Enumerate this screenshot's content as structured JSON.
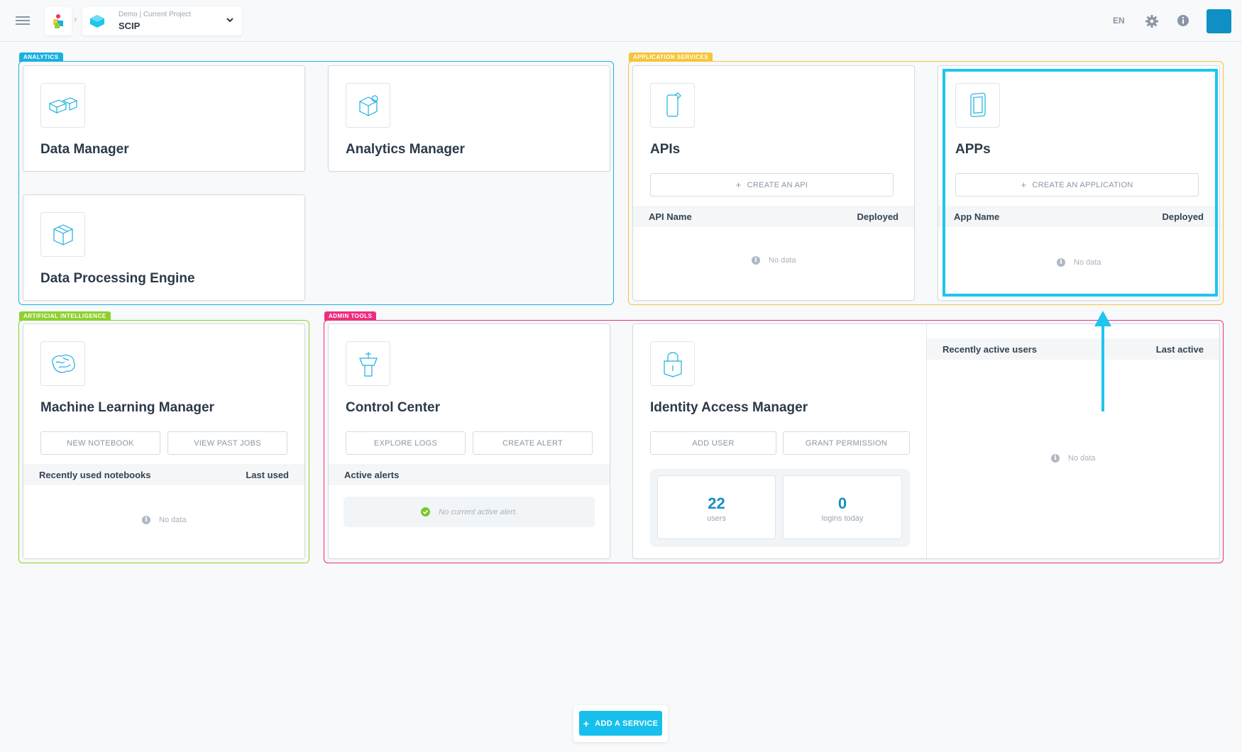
{
  "header": {
    "project_subtitle": "Demo | Current Project",
    "project_name": "SCIP",
    "language": "EN"
  },
  "groups": {
    "analytics": {
      "tag": "ANALYTICS",
      "color": "#1ab0e0"
    },
    "application_services": {
      "tag": "APPLICATION SERVICES",
      "color": "#f7c539"
    },
    "artificial_intelligence": {
      "tag": "ARTIFICIAL INTELLIGENCE",
      "color": "#8dd12e"
    },
    "admin_tools": {
      "tag": "ADMIN TOOLS",
      "color": "#ef2d7e"
    }
  },
  "cards": {
    "data_manager": {
      "title": "Data Manager"
    },
    "analytics_manager": {
      "title": "Analytics Manager"
    },
    "data_processing_engine": {
      "title": "Data Processing Engine"
    },
    "apis": {
      "title": "APIs",
      "create_button": "CREATE AN API",
      "col_left": "API Name",
      "col_right": "Deployed",
      "empty": "No data"
    },
    "apps": {
      "title": "APPs",
      "create_button": "CREATE AN APPLICATION",
      "col_left": "App Name",
      "col_right": "Deployed",
      "empty": "No data"
    },
    "ml_manager": {
      "title": "Machine Learning Manager",
      "btn_new_notebook": "NEW NOTEBOOK",
      "btn_view_jobs": "VIEW PAST JOBS",
      "col_left": "Recently used notebooks",
      "col_right": "Last used",
      "empty": "No data"
    },
    "control_center": {
      "title": "Control Center",
      "btn_explore_logs": "EXPLORE LOGS",
      "btn_create_alert": "CREATE ALERT",
      "section": "Active alerts",
      "empty": "No current active alert."
    },
    "identity_access_manager": {
      "title": "Identity Access Manager",
      "btn_add_user": "ADD USER",
      "btn_grant_permission": "GRANT PERMISSION",
      "stat_users_value": "22",
      "stat_users_label": "users",
      "stat_logins_value": "0",
      "stat_logins_label": "logins today",
      "col_left": "Recently active users",
      "col_right": "Last active",
      "empty": "No data"
    }
  },
  "footer": {
    "add_service": "ADD A SERVICE"
  }
}
